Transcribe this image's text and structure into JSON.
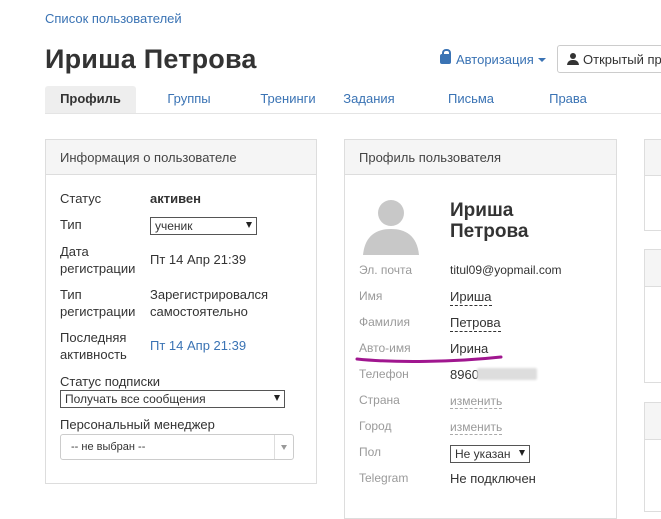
{
  "breadcrumb": "Список пользователей",
  "page_title": "Ириша Петрова",
  "auth_menu": "Авторизация",
  "open_button": "Открытый проф",
  "tabs": [
    "Профиль",
    "Группы",
    "Тренинги",
    "Задания",
    "Письма",
    "Права"
  ],
  "user_info": {
    "title": "Информация о пользователе",
    "status_label": "Статус",
    "status_value": "активен",
    "type_label": "Тип",
    "type_value": "ученик",
    "reg_date_label_1": "Дата",
    "reg_date_label_2": "регистрации",
    "reg_date_value": "Пт 14 Апр 21:39",
    "reg_type_label_1": "Тип",
    "reg_type_label_2": "регистрации",
    "reg_type_value_1": "Зарегистрировался",
    "reg_type_value_2": "самостоятельно",
    "last_activity_label_1": "Последняя",
    "last_activity_label_2": "активность",
    "last_activity_value": "Пт 14 Апр 21:39",
    "subscription_label": "Статус подписки",
    "subscription_value": "Получать все сообщения",
    "manager_label": "Персональный менеджер",
    "manager_value": "-- не выбран --"
  },
  "profile": {
    "title": "Профиль пользователя",
    "name_line1": "Ириша",
    "name_line2": "Петрова",
    "fields": [
      {
        "label": "Эл. почта",
        "value": "titul09@yopmail.com"
      },
      {
        "label": "Имя",
        "value": "Ириша"
      },
      {
        "label": "Фамилия",
        "value": "Петрова"
      },
      {
        "label": "Авто-имя",
        "value": "Ирина"
      },
      {
        "label": "Телефон",
        "value": "8960"
      },
      {
        "label": "Страна",
        "value": "изменить"
      },
      {
        "label": "Город",
        "value": "изменить"
      },
      {
        "label": "Пол",
        "value": "Не указан"
      },
      {
        "label": "Telegram",
        "value": "Не подключен"
      }
    ]
  },
  "colors": {
    "link": "#3a73b4",
    "highlight_underline": "#a0168f",
    "panel_header": "#f5f5f5"
  }
}
